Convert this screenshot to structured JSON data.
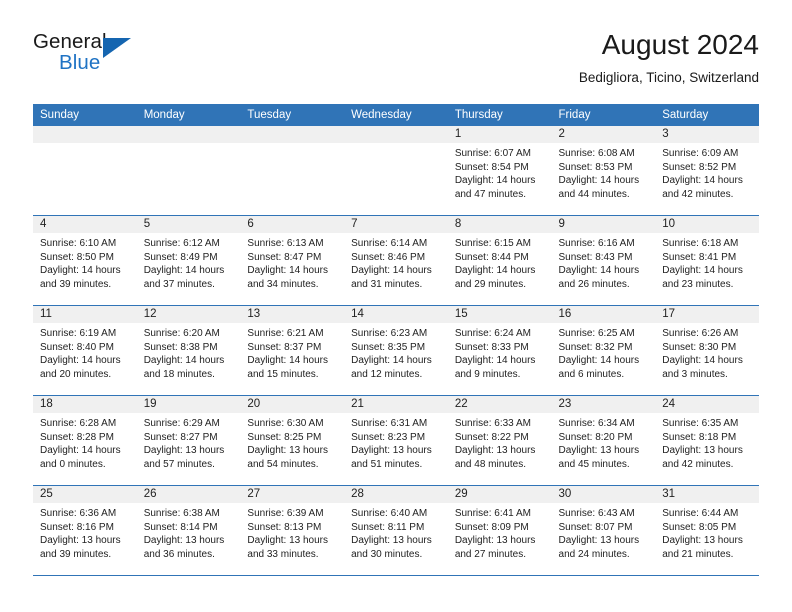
{
  "logo": {
    "word_one": "General",
    "word_two": "Blue",
    "triangle_icon": "triangle-icon",
    "brand_blue": "#1f73c4"
  },
  "header": {
    "title": "August 2024",
    "location": "Bedigliora, Ticino, Switzerland"
  },
  "calendar": {
    "header_bg": "#3074b7",
    "daynum_bg": "#f0f0f0",
    "weekdays": [
      "Sunday",
      "Monday",
      "Tuesday",
      "Wednesday",
      "Thursday",
      "Friday",
      "Saturday"
    ],
    "weeks": [
      [
        {
          "day": "",
          "lines": []
        },
        {
          "day": "",
          "lines": []
        },
        {
          "day": "",
          "lines": []
        },
        {
          "day": "",
          "lines": []
        },
        {
          "day": "1",
          "lines": [
            "Sunrise: 6:07 AM",
            "Sunset: 8:54 PM",
            "Daylight: 14 hours",
            "and 47 minutes."
          ]
        },
        {
          "day": "2",
          "lines": [
            "Sunrise: 6:08 AM",
            "Sunset: 8:53 PM",
            "Daylight: 14 hours",
            "and 44 minutes."
          ]
        },
        {
          "day": "3",
          "lines": [
            "Sunrise: 6:09 AM",
            "Sunset: 8:52 PM",
            "Daylight: 14 hours",
            "and 42 minutes."
          ]
        }
      ],
      [
        {
          "day": "4",
          "lines": [
            "Sunrise: 6:10 AM",
            "Sunset: 8:50 PM",
            "Daylight: 14 hours",
            "and 39 minutes."
          ]
        },
        {
          "day": "5",
          "lines": [
            "Sunrise: 6:12 AM",
            "Sunset: 8:49 PM",
            "Daylight: 14 hours",
            "and 37 minutes."
          ]
        },
        {
          "day": "6",
          "lines": [
            "Sunrise: 6:13 AM",
            "Sunset: 8:47 PM",
            "Daylight: 14 hours",
            "and 34 minutes."
          ]
        },
        {
          "day": "7",
          "lines": [
            "Sunrise: 6:14 AM",
            "Sunset: 8:46 PM",
            "Daylight: 14 hours",
            "and 31 minutes."
          ]
        },
        {
          "day": "8",
          "lines": [
            "Sunrise: 6:15 AM",
            "Sunset: 8:44 PM",
            "Daylight: 14 hours",
            "and 29 minutes."
          ]
        },
        {
          "day": "9",
          "lines": [
            "Sunrise: 6:16 AM",
            "Sunset: 8:43 PM",
            "Daylight: 14 hours",
            "and 26 minutes."
          ]
        },
        {
          "day": "10",
          "lines": [
            "Sunrise: 6:18 AM",
            "Sunset: 8:41 PM",
            "Daylight: 14 hours",
            "and 23 minutes."
          ]
        }
      ],
      [
        {
          "day": "11",
          "lines": [
            "Sunrise: 6:19 AM",
            "Sunset: 8:40 PM",
            "Daylight: 14 hours",
            "and 20 minutes."
          ]
        },
        {
          "day": "12",
          "lines": [
            "Sunrise: 6:20 AM",
            "Sunset: 8:38 PM",
            "Daylight: 14 hours",
            "and 18 minutes."
          ]
        },
        {
          "day": "13",
          "lines": [
            "Sunrise: 6:21 AM",
            "Sunset: 8:37 PM",
            "Daylight: 14 hours",
            "and 15 minutes."
          ]
        },
        {
          "day": "14",
          "lines": [
            "Sunrise: 6:23 AM",
            "Sunset: 8:35 PM",
            "Daylight: 14 hours",
            "and 12 minutes."
          ]
        },
        {
          "day": "15",
          "lines": [
            "Sunrise: 6:24 AM",
            "Sunset: 8:33 PM",
            "Daylight: 14 hours",
            "and 9 minutes."
          ]
        },
        {
          "day": "16",
          "lines": [
            "Sunrise: 6:25 AM",
            "Sunset: 8:32 PM",
            "Daylight: 14 hours",
            "and 6 minutes."
          ]
        },
        {
          "day": "17",
          "lines": [
            "Sunrise: 6:26 AM",
            "Sunset: 8:30 PM",
            "Daylight: 14 hours",
            "and 3 minutes."
          ]
        }
      ],
      [
        {
          "day": "18",
          "lines": [
            "Sunrise: 6:28 AM",
            "Sunset: 8:28 PM",
            "Daylight: 14 hours",
            "and 0 minutes."
          ]
        },
        {
          "day": "19",
          "lines": [
            "Sunrise: 6:29 AM",
            "Sunset: 8:27 PM",
            "Daylight: 13 hours",
            "and 57 minutes."
          ]
        },
        {
          "day": "20",
          "lines": [
            "Sunrise: 6:30 AM",
            "Sunset: 8:25 PM",
            "Daylight: 13 hours",
            "and 54 minutes."
          ]
        },
        {
          "day": "21",
          "lines": [
            "Sunrise: 6:31 AM",
            "Sunset: 8:23 PM",
            "Daylight: 13 hours",
            "and 51 minutes."
          ]
        },
        {
          "day": "22",
          "lines": [
            "Sunrise: 6:33 AM",
            "Sunset: 8:22 PM",
            "Daylight: 13 hours",
            "and 48 minutes."
          ]
        },
        {
          "day": "23",
          "lines": [
            "Sunrise: 6:34 AM",
            "Sunset: 8:20 PM",
            "Daylight: 13 hours",
            "and 45 minutes."
          ]
        },
        {
          "day": "24",
          "lines": [
            "Sunrise: 6:35 AM",
            "Sunset: 8:18 PM",
            "Daylight: 13 hours",
            "and 42 minutes."
          ]
        }
      ],
      [
        {
          "day": "25",
          "lines": [
            "Sunrise: 6:36 AM",
            "Sunset: 8:16 PM",
            "Daylight: 13 hours",
            "and 39 minutes."
          ]
        },
        {
          "day": "26",
          "lines": [
            "Sunrise: 6:38 AM",
            "Sunset: 8:14 PM",
            "Daylight: 13 hours",
            "and 36 minutes."
          ]
        },
        {
          "day": "27",
          "lines": [
            "Sunrise: 6:39 AM",
            "Sunset: 8:13 PM",
            "Daylight: 13 hours",
            "and 33 minutes."
          ]
        },
        {
          "day": "28",
          "lines": [
            "Sunrise: 6:40 AM",
            "Sunset: 8:11 PM",
            "Daylight: 13 hours",
            "and 30 minutes."
          ]
        },
        {
          "day": "29",
          "lines": [
            "Sunrise: 6:41 AM",
            "Sunset: 8:09 PM",
            "Daylight: 13 hours",
            "and 27 minutes."
          ]
        },
        {
          "day": "30",
          "lines": [
            "Sunrise: 6:43 AM",
            "Sunset: 8:07 PM",
            "Daylight: 13 hours",
            "and 24 minutes."
          ]
        },
        {
          "day": "31",
          "lines": [
            "Sunrise: 6:44 AM",
            "Sunset: 8:05 PM",
            "Daylight: 13 hours",
            "and 21 minutes."
          ]
        }
      ]
    ]
  }
}
